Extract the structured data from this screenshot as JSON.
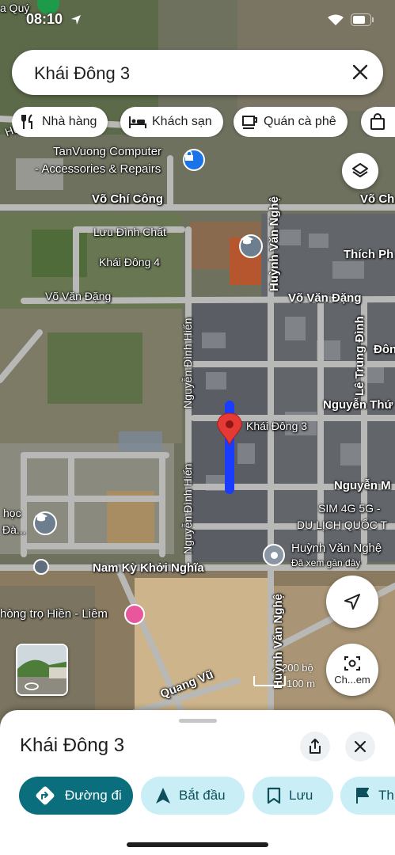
{
  "status": {
    "time": "08:10"
  },
  "search": {
    "query": "Khái Đông 3"
  },
  "chips": [
    {
      "label": "Nhà hàng",
      "icon": "restaurant-icon"
    },
    {
      "label": "Khách sạn",
      "icon": "hotel-icon"
    },
    {
      "label": "Quán cà phê",
      "icon": "cafe-icon"
    },
    {
      "label": "",
      "icon": "shopping-icon"
    }
  ],
  "map": {
    "labels": {
      "tl_quy": "a Quý",
      "tanvuong_1": "TanVuong Computer",
      "tanvuong_2": "- Accessories & Repairs",
      "vo_chi_cong": "Võ Chí Công",
      "vo_chi_cong_right": "Võ Ch",
      "luu_dinh_chat": "Lưu Đình Chất",
      "khai_dong_4": "Khái Đông 4",
      "thich_ph": "Thích Ph",
      "vo_van_dang_left": "Võ Văn Đặng",
      "vo_van_dang_right": "Võ Văn Đặng",
      "huynh_van_nghe_top": "Huỳnh Văn Nghệ",
      "nguyen_dinh_hien_top": "Nguyễn Đình Hiến",
      "le_trung_dinh": "Lê Trung Đình",
      "don": "Đôn",
      "nguyen_thu": "Nguyễn Thứ",
      "khai_dong_3": "Khái Đông 3",
      "nguyen_m": "Nguyễn M",
      "sim": "SIM 4G 5G -",
      "du_lich": "DU LỊCH QUỐC T",
      "hoc": "học",
      "da": "Đà...",
      "nguyen_dinh_hien_bottom": "Nguyễn Đình Hiến",
      "huynh_van_nghe_pin": "Huỳnh Văn Nghệ",
      "da_xem": "Đã xem gần đây",
      "nam_ky": "Nam Kỳ Khởi Nghĩa",
      "nha_tro": "hòng trọ Hiền - Liêm",
      "huynh_van_nghe_bottom": "Huỳnh Văn Nghệ",
      "quang_vu": "Quang Vũ",
      "hu": "Hu"
    },
    "scale": {
      "feet": "200 bộ",
      "meters": "100 m"
    },
    "explore_label": "Ch...em"
  },
  "sheet": {
    "title": "Khái Đông 3",
    "actions": [
      {
        "label": "Đường đi",
        "style": "primary"
      },
      {
        "label": "Bắt đầu",
        "style": "secondary"
      },
      {
        "label": "Lưu",
        "style": "secondary"
      },
      {
        "label": "Th",
        "style": "secondary"
      }
    ]
  },
  "colors": {
    "route": "#1a3cff",
    "pin": "#e53935",
    "primary": "#0b6e7d",
    "secondary": "#c9eef6"
  }
}
